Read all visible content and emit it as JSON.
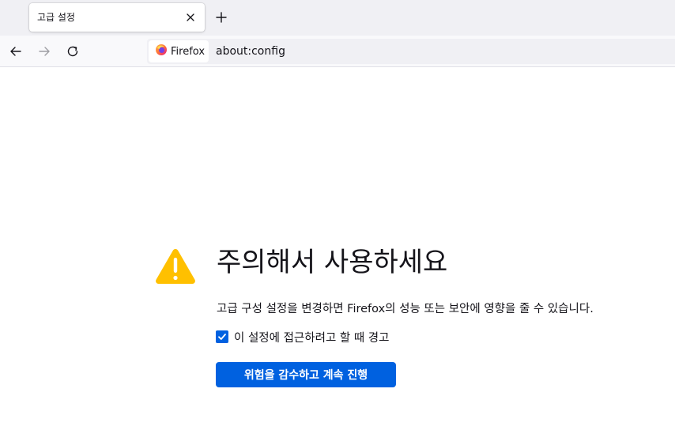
{
  "tab": {
    "title": "고급 설정",
    "close_icon": "close-icon"
  },
  "new_tab_icon": "plus-icon",
  "nav": {
    "back_icon": "back-arrow-icon",
    "forward_icon": "forward-arrow-icon",
    "reload_icon": "reload-icon"
  },
  "urlbar": {
    "identity_label": "Firefox",
    "identity_icon": "firefox-logo-icon",
    "url": "about:config"
  },
  "warning": {
    "icon": "warning-triangle-icon",
    "title": "주의해서 사용하세요",
    "description": "고급 구성 설정을 변경하면 Firefox의 성능 또는 보안에 영향을 줄 수 있습니다.",
    "checkbox_label": "이 설정에 접근하려고 할 때 경고",
    "checkbox_checked": true,
    "accept_button": "위험을 감수하고 계속 진행"
  },
  "colors": {
    "accent": "#0061e0",
    "warning": "#ffc000",
    "tabstrip_bg": "#f0f0f4",
    "navbar_bg": "#f9f9fb"
  }
}
